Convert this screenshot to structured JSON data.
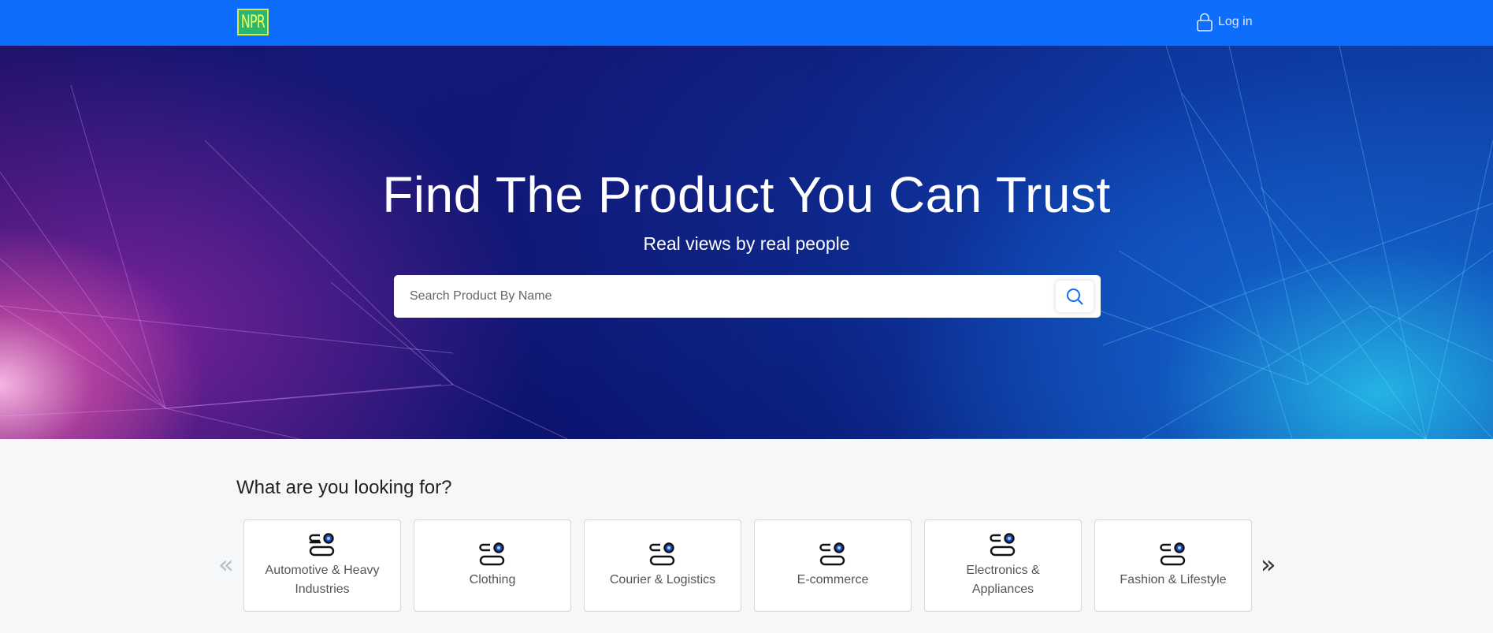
{
  "nav": {
    "logo_text": "NPR",
    "login_label": "Log in",
    "bar_color": "#0d6efd"
  },
  "hero": {
    "title": "Find The Product You Can Trust",
    "subtitle": "Real views by real people",
    "search_placeholder": "Search Product By Name",
    "search_value": ""
  },
  "categories": {
    "heading": "What are you looking for?",
    "prev_arrow": "«",
    "next_arrow": "»",
    "items": [
      {
        "label": "Automotive & Heavy Industries",
        "icon": "category-icon"
      },
      {
        "label": "Clothing",
        "icon": "category-icon"
      },
      {
        "label": "Courier & Logistics",
        "icon": "category-icon"
      },
      {
        "label": "E-commerce",
        "icon": "category-icon"
      },
      {
        "label": "Electronics & Appliances",
        "icon": "category-icon"
      },
      {
        "label": "Fashion & Lifestyle",
        "icon": "category-icon"
      }
    ]
  }
}
